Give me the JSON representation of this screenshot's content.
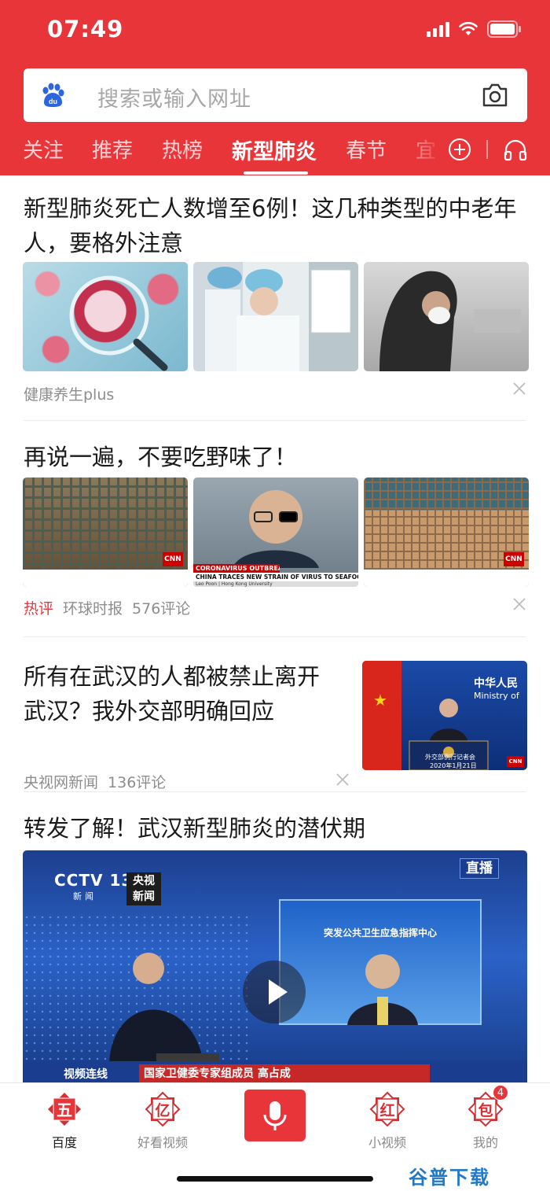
{
  "status_bar": {
    "time": "07:49"
  },
  "search": {
    "placeholder": "搜索或输入网址",
    "logo_text": "du"
  },
  "tabs": [
    {
      "label": "关注"
    },
    {
      "label": "推荐"
    },
    {
      "label": "热榜"
    },
    {
      "label": "新型肺炎",
      "active": true
    },
    {
      "label": "春节"
    },
    {
      "label": "宜"
    }
  ],
  "articles": [
    {
      "title": "新型肺炎死亡人数增至6例！这几种类型的中老年人，要格外注意",
      "source": "健康养生plus",
      "images": [
        "virus-illustration-image",
        "medical-staff-image",
        "masked-person-image"
      ]
    },
    {
      "title": "再说一遍，不要吃野味了！",
      "tag": "热评",
      "source": "环球时报",
      "comments": "576评论",
      "images": [
        "caged-animals-image",
        "cnn-interview-image",
        "market-cages-image"
      ],
      "video_caption": "CHINA TRACES NEW STRAIN OF VIRUS TO SEAFOOD MARKET",
      "breaking_label": "CORONAVIRUS OUTBREAK",
      "speaker": "Leo Poon | Hong Kong University"
    },
    {
      "title": "所有在武汉的人都被禁止离开武汉？我外交部明确回应",
      "source": "央视网新闻",
      "comments": "136评论",
      "thumb_text": "中华人民",
      "thumb_text_en": "Ministry of",
      "thumb_caption": "外交部例行记者会",
      "thumb_date": "2020年1月21日"
    },
    {
      "title": "转发了解！武汉新型肺炎的潜伏期",
      "video_channel": "CCTV 13",
      "video_channel_sub": "新闻",
      "video_badge": "央视新闻",
      "live_label": "直播",
      "video_screen_text": "突发公共卫生应急指挥中心",
      "video_ticker_a": "视频连线",
      "video_ticker_b": "国家卫健委专家组成员 高占成"
    }
  ],
  "bottom_nav": [
    {
      "label": "百度",
      "glyph": "五",
      "active": true
    },
    {
      "label": "好看视频",
      "glyph": "亿"
    },
    {
      "label": "",
      "glyph": "mic"
    },
    {
      "label": "小视频",
      "glyph": "红"
    },
    {
      "label": "我的",
      "glyph": "包",
      "badge": "4"
    }
  ],
  "watermark": "谷普下载",
  "colors": {
    "brand_red": "#e8353a",
    "text": "#1a1a1a",
    "meta": "#8d8d8d"
  }
}
